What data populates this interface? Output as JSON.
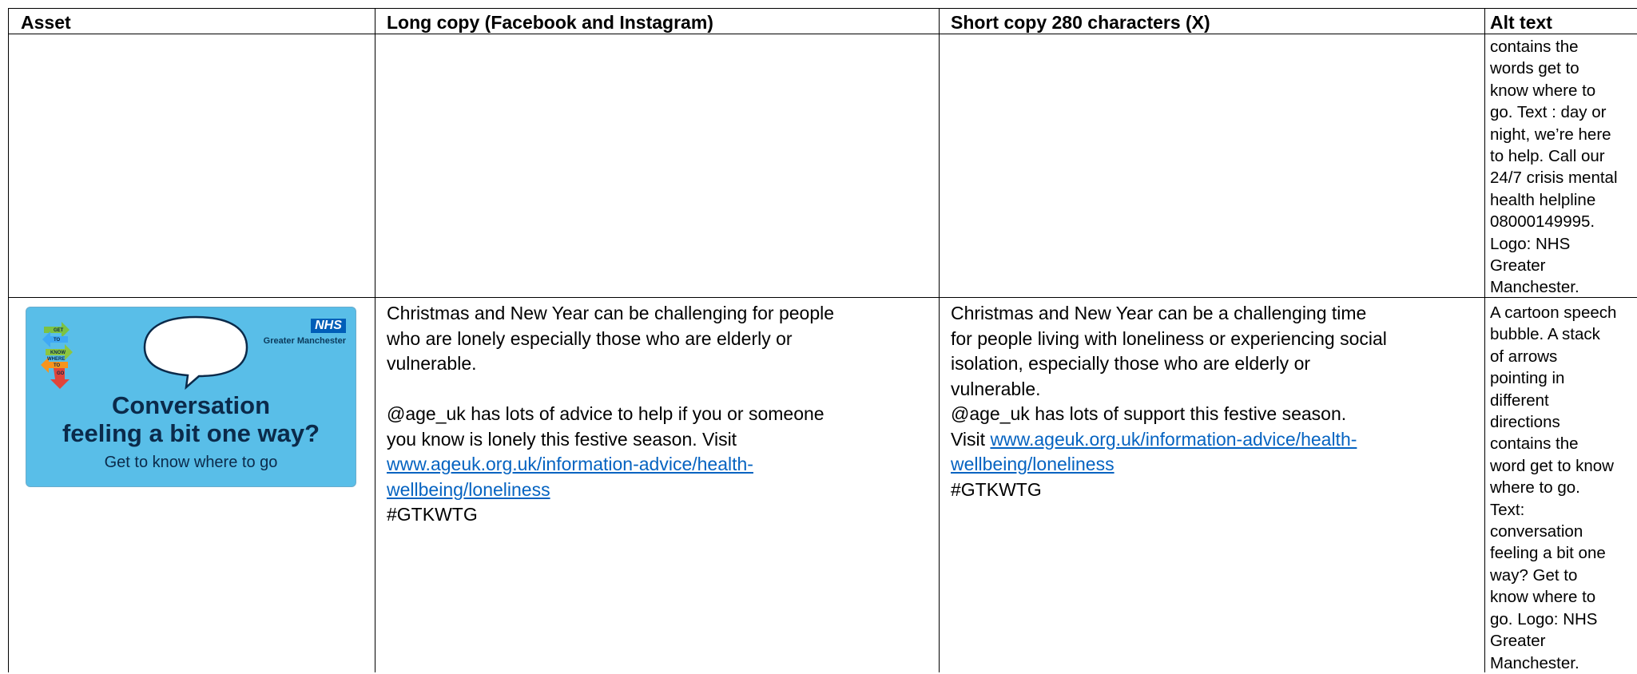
{
  "headers": {
    "asset": "Asset",
    "long_copy": "Long copy (Facebook and Instagram)",
    "short_copy": "Short copy 280 characters (X)",
    "alt_text": "Alt text"
  },
  "row1": {
    "alt_lines": [
      "contains the",
      "words get to",
      "know where to",
      "go. Text : day or",
      "night, we’re here",
      "to help. Call our",
      "24/7 crisis mental",
      "health helpline",
      "08000149995.",
      "Logo: NHS",
      "Greater",
      "Manchester."
    ]
  },
  "row2": {
    "asset": {
      "nhs_logo": "NHS",
      "nhs_region": "Greater Manchester",
      "arrow_words": [
        "GET",
        "TO",
        "KNOW",
        "WHERE",
        "TO",
        "GO"
      ],
      "headline_line1": "Conversation",
      "headline_line2": "feeling a bit one way?",
      "tagline": "Get to know where to go",
      "colors": {
        "background": "#59bee8",
        "headline": "#0b2a4a",
        "nhs_blue": "#005eb8"
      }
    },
    "long_copy": {
      "line1": "Christmas and New Year can be challenging for people",
      "line2": "who are lonely especially those who are elderly or",
      "line3": "vulnerable.",
      "line4": "@age_uk has lots of advice to help if you or someone",
      "line5": "you know is lonely this festive season. Visit",
      "link_line1": "www.ageuk.org.uk/information-advice/health-",
      "link_line2": "wellbeing/loneliness",
      "hashtag": "#GTKWTG"
    },
    "short_copy": {
      "line1": "Christmas and New Year can be a challenging time",
      "line2": "for people living with loneliness or experiencing social",
      "line3": "isolation, especially those who are elderly or",
      "line4": "vulnerable.",
      "line5": "@age_uk has lots of support this festive season.",
      "visit": "Visit",
      "link_line1": "www.ageuk.org.uk/information-advice/health-",
      "link_line2": "wellbeing/loneliness",
      "hashtag": "#GTKWTG"
    },
    "alt_lines": [
      "A cartoon speech",
      "bubble. A stack",
      "of arrows",
      "pointing in",
      "different",
      "directions",
      "contains the",
      "word get to know",
      "where to go.",
      "Text:",
      "conversation",
      "feeling a bit one",
      "way? Get to",
      "know where to",
      "go. Logo: NHS",
      "Greater",
      "Manchester."
    ]
  }
}
